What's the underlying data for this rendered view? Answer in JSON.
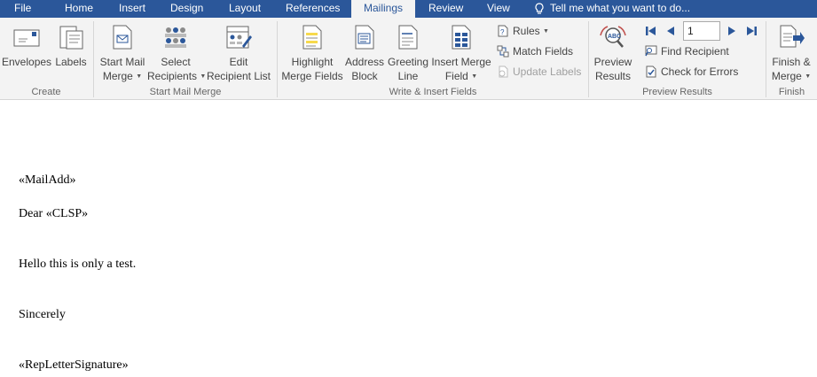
{
  "tabs": [
    {
      "label": "File"
    },
    {
      "label": "Home"
    },
    {
      "label": "Insert"
    },
    {
      "label": "Design"
    },
    {
      "label": "Layout"
    },
    {
      "label": "References"
    },
    {
      "label": "Mailings",
      "active": true
    },
    {
      "label": "Review"
    },
    {
      "label": "View"
    }
  ],
  "tell_me": "Tell me what you want to do...",
  "groups": {
    "create": "Create",
    "start_mail_merge": "Start Mail Merge",
    "write_insert": "Write & Insert Fields",
    "preview": "Preview Results",
    "finish": "Finish"
  },
  "buttons": {
    "envelopes": "Envelopes",
    "labels": "Labels",
    "start_mail_merge_1": "Start Mail",
    "start_mail_merge_2": "Merge",
    "select_recipients_1": "Select",
    "select_recipients_2": "Recipients",
    "edit_list_1": "Edit",
    "edit_list_2": "Recipient List",
    "highlight_1": "Highlight",
    "highlight_2": "Merge Fields",
    "address_1": "Address",
    "address_2": "Block",
    "greeting_1": "Greeting",
    "greeting_2": "Line",
    "insert_field_1": "Insert Merge",
    "insert_field_2": "Field",
    "rules": "Rules",
    "match_fields": "Match Fields",
    "update_labels": "Update Labels",
    "preview_1": "Preview",
    "preview_2": "Results",
    "find_recipient": "Find Recipient",
    "check_errors": "Check for Errors",
    "finish_1": "Finish &",
    "finish_2": "Merge"
  },
  "record_value": "1",
  "colors": {
    "tab_bar": "#2b579a",
    "ribbon": "#f3f3f3",
    "icon_blue": "#2b579a"
  },
  "document": {
    "lines": [
      "«MailAdd»",
      "Dear «CLSP»",
      "Hello this is only a test.",
      "Sincerely",
      "«RepLetterSignature»"
    ]
  }
}
